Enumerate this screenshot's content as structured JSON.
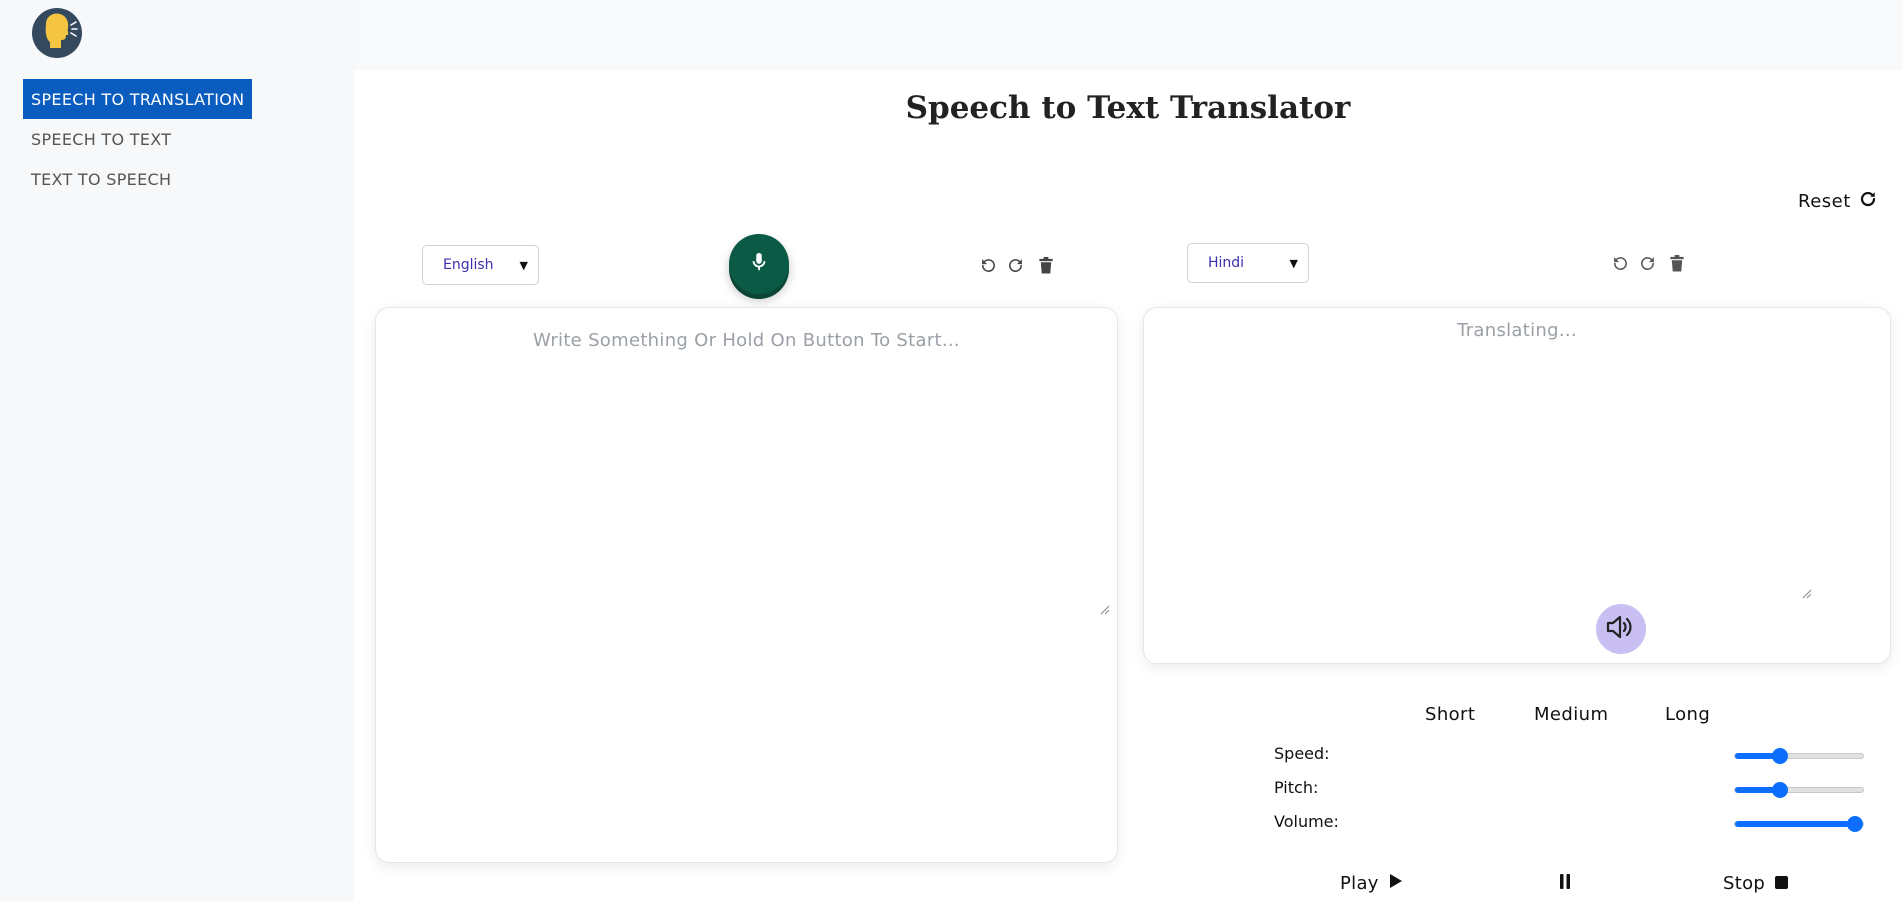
{
  "sidebar": {
    "items": [
      {
        "label": "SPEECH TO TRANSLATION",
        "active": true
      },
      {
        "label": "SPEECH TO TEXT",
        "active": false
      },
      {
        "label": "TEXT TO SPEECH",
        "active": false
      }
    ]
  },
  "main": {
    "title": "Speech to Text Translator",
    "reset_label": "Reset"
  },
  "source": {
    "language": "English",
    "placeholder": "Write Something Or Hold On Button To Start..."
  },
  "target": {
    "language": "Hindi",
    "placeholder": "Translating..."
  },
  "lengths": {
    "short": "Short",
    "medium": "Medium",
    "long": "Long"
  },
  "sliders": {
    "speed": {
      "label": "Speed:",
      "value": 0.35
    },
    "pitch": {
      "label": "Pitch:",
      "value": 0.35
    },
    "volume": {
      "label": "Volume:",
      "value": 1.0
    }
  },
  "controls": {
    "play": "Play",
    "stop": "Stop"
  },
  "colors": {
    "active_nav": "#0a5cbf",
    "mic": "#0b5a45",
    "speaker": "#c9bff2",
    "slider": "#0d6efd"
  }
}
